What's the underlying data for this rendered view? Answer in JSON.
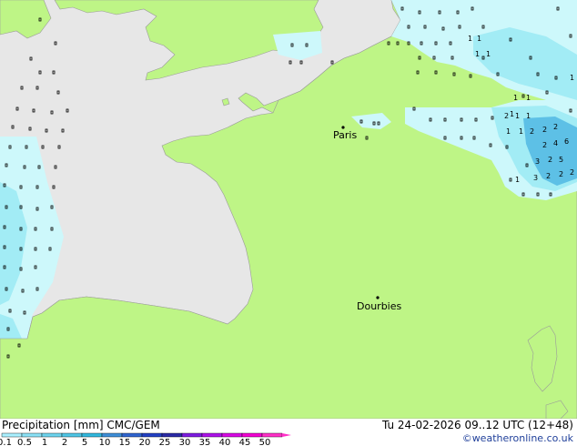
{
  "map": {
    "cities": [
      {
        "name": "Paris"
      },
      {
        "name": "Dourbies"
      }
    ]
  },
  "legend": {
    "title": "Precipitation [mm]  CMC/GEM",
    "datetime": "Tu 24-02-2026 09..12 UTC (12+48)",
    "credit": "©weatheronline.co.uk",
    "ticks": [
      "0.1",
      "0.5",
      "1",
      "2",
      "5",
      "10",
      "15",
      "20",
      "25",
      "30",
      "35",
      "40",
      "45",
      "50"
    ],
    "colors": [
      "#aaf0ff",
      "#8be2f6",
      "#6dd4ee",
      "#4fc6e6",
      "#31b8de",
      "#3e8ed8",
      "#2f64cf",
      "#2340c4",
      "#2b2aa6",
      "#7e1ce0",
      "#ad12e8",
      "#d80ae4",
      "#f200d2",
      "#ff30c8"
    ]
  },
  "colors": {
    "land": "#bef586",
    "sea": "#e7e7e7",
    "outline": "#9a9a9a",
    "rain_light": "#cdf8fb",
    "rain_mid": "#a2ecf5",
    "rain_heavy": "#5dc0e6"
  }
}
